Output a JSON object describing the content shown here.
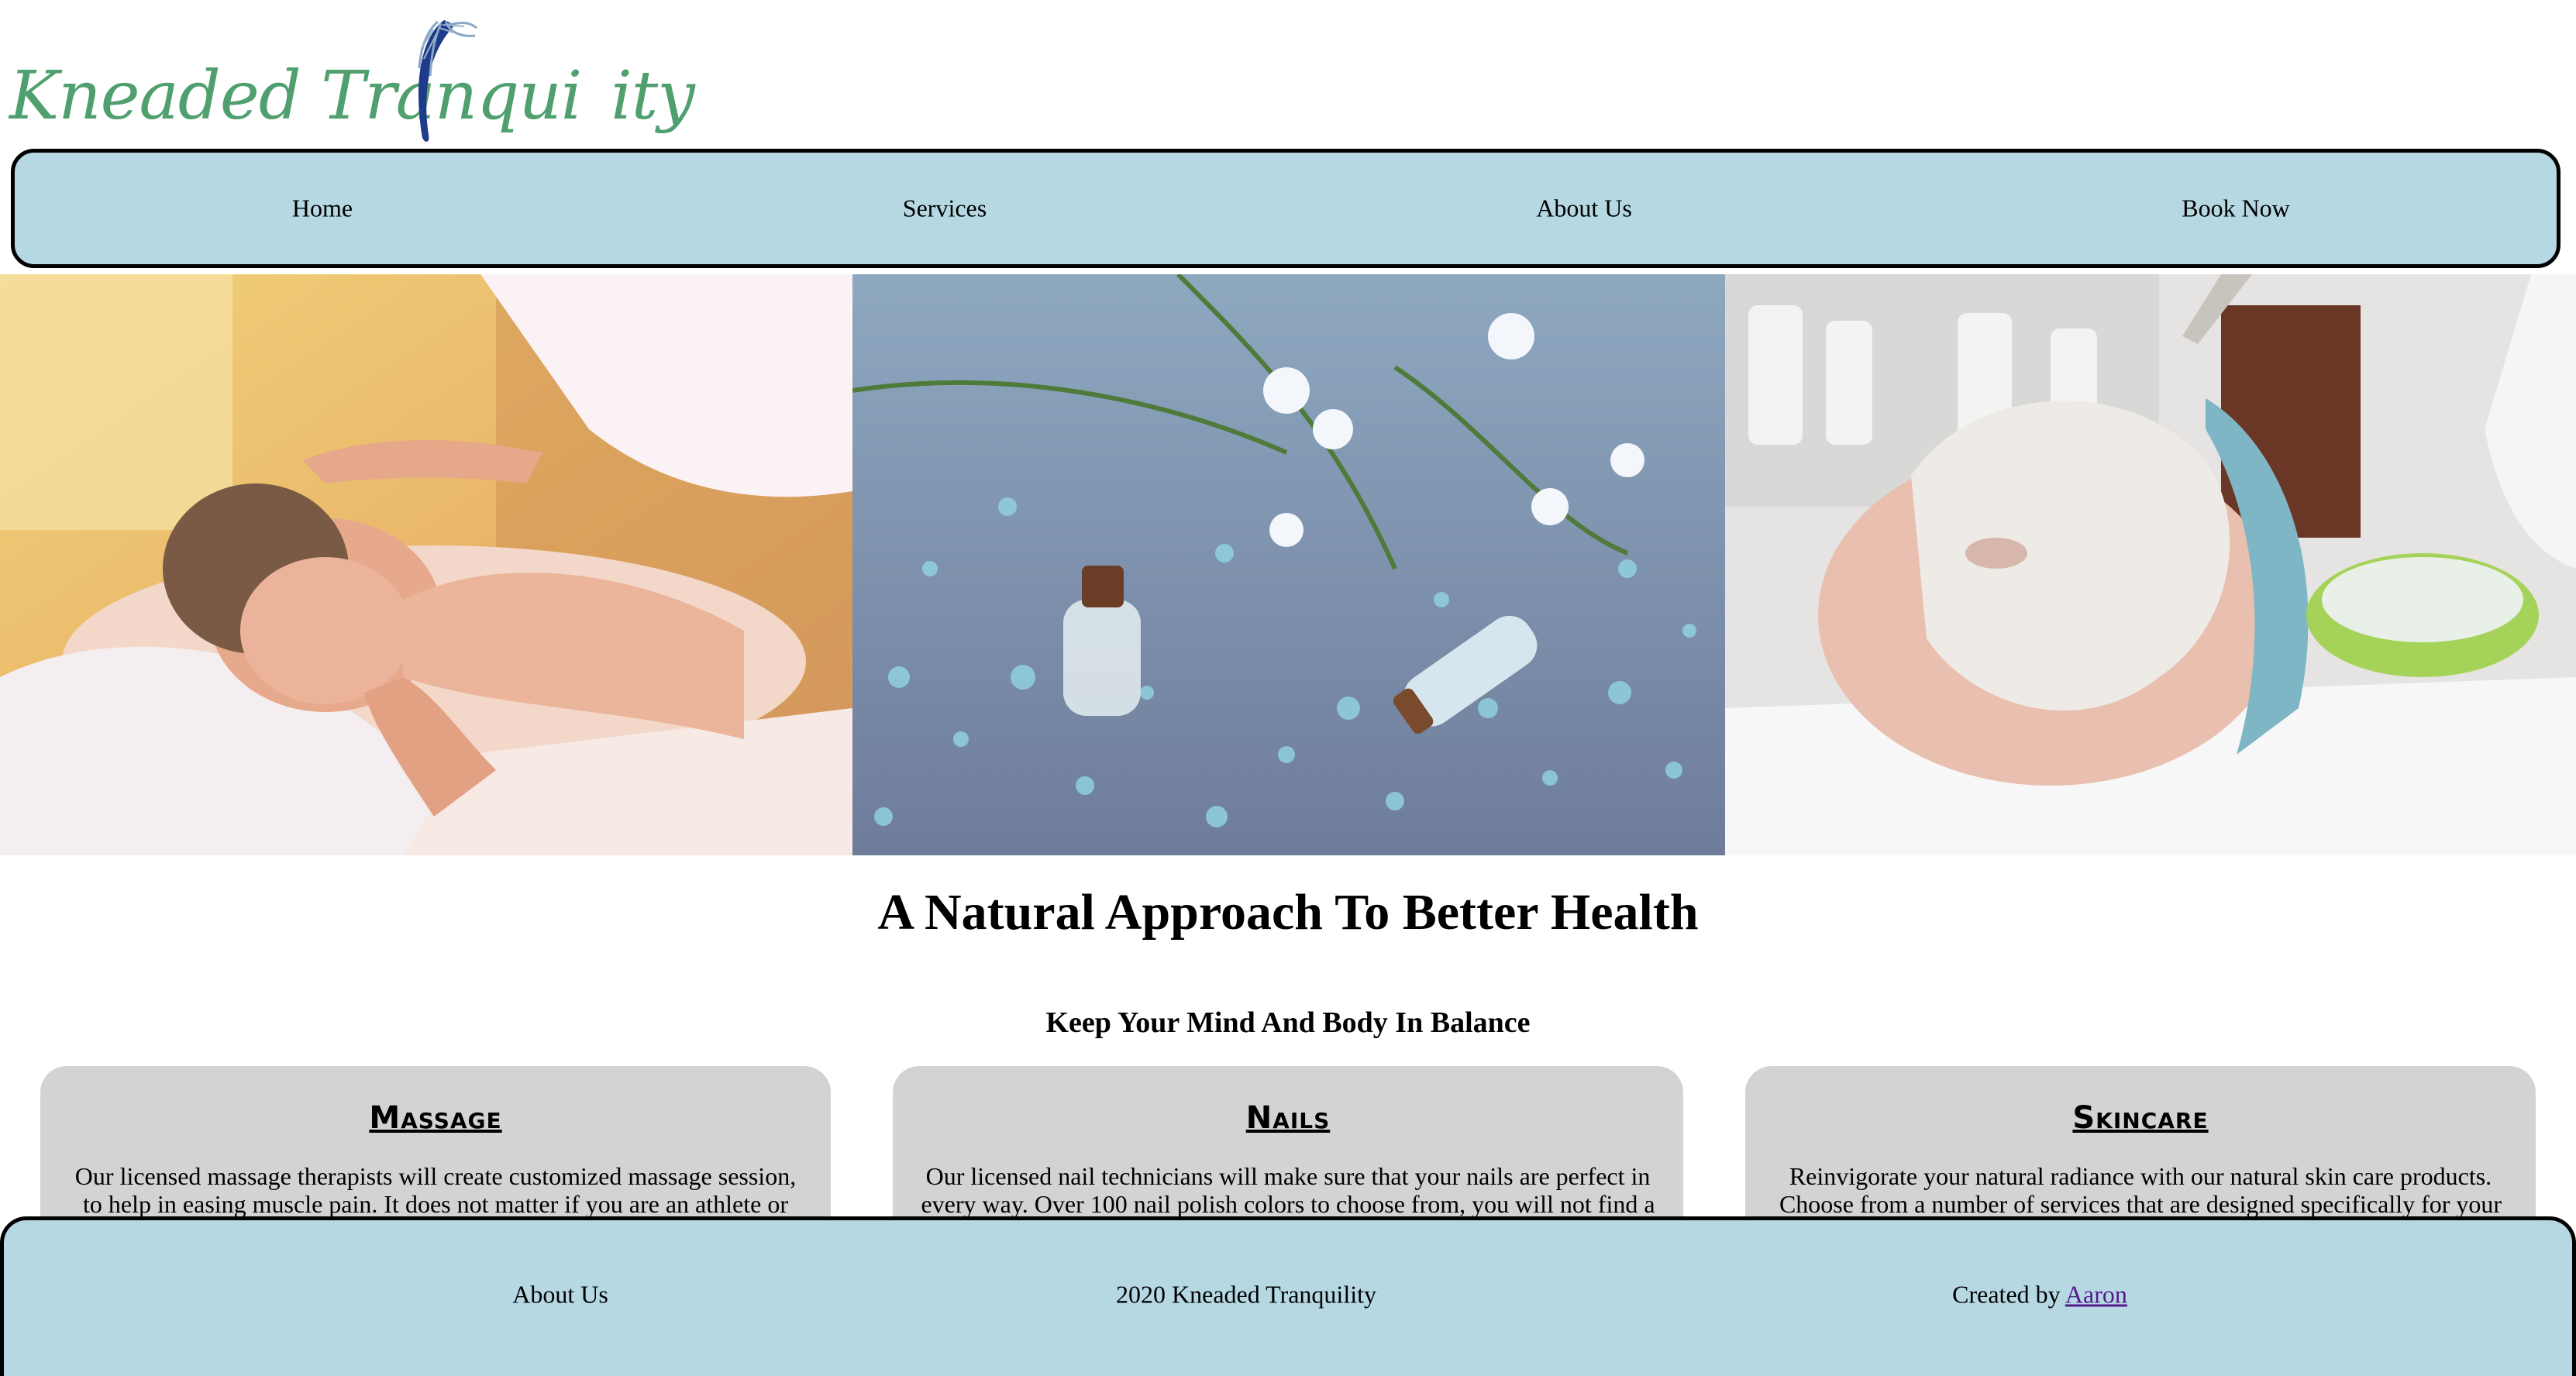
{
  "brand": {
    "logo_text_left": "Kneaded Tranqui",
    "logo_text_right": "ity",
    "logo_color": "#4fa06e",
    "swoosh_color": "#1e3a8a"
  },
  "nav": {
    "items": [
      {
        "label": "Home"
      },
      {
        "label": "Services"
      },
      {
        "label": "About Us"
      },
      {
        "label": "Book Now"
      }
    ],
    "background": "#b5d8e3"
  },
  "hero": {
    "images": [
      "massage-photo",
      "bath-salts-photo",
      "facial-mask-photo"
    ]
  },
  "main": {
    "headline": "A Natural Approach To Better Health",
    "subheadline": "Keep Your Mind And Body In Balance"
  },
  "services": [
    {
      "title": "Massage",
      "text": "Our licensed massage therapists will create customized massage session, to help in easing muscle pain. It does not matter if you are an athlete or"
    },
    {
      "title": "Nails",
      "text": "Our licensed nail technicians will make sure that your nails are perfect in every way. Over 100 nail polish colors to choose from, you will not find a"
    },
    {
      "title": "Skincare",
      "text": "Reinvigorate your natural radiance with our natural skin care products. Choose from a number of services that are designed specifically for your"
    }
  ],
  "footer": {
    "about": "About Us",
    "copyright": "2020 Kneaded Tranquility",
    "created_by": "Created by",
    "author": "Aaron"
  }
}
